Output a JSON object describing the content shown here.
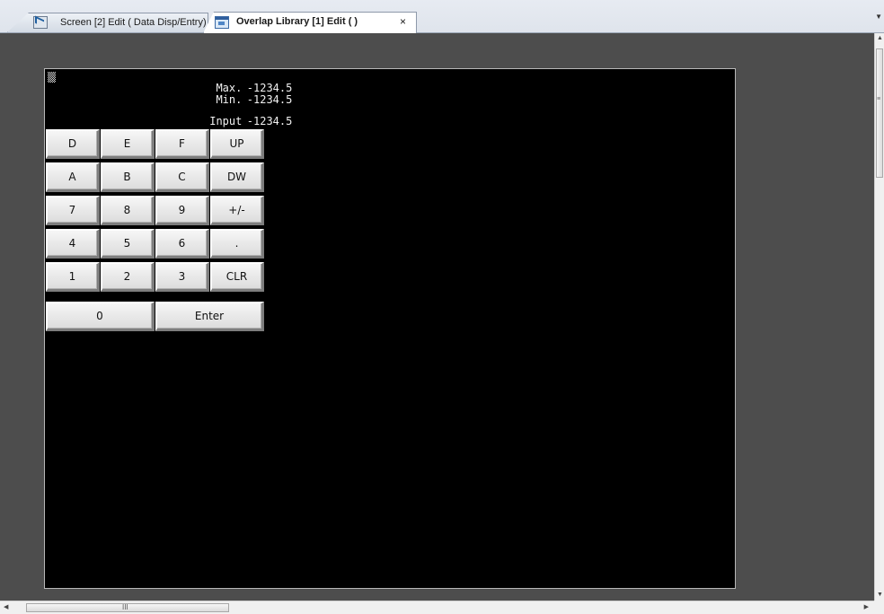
{
  "tabs": [
    {
      "label": "Screen [2] Edit ( Data Disp/Entry)",
      "icon": "screen-edit-icon",
      "active": false
    },
    {
      "label": "Overlap Library [1] Edit (          )",
      "icon": "overlap-library-icon",
      "active": true,
      "close": "×"
    }
  ],
  "hmi": {
    "background": "#000000",
    "max_label": "Max.",
    "max_value": "-1234.5",
    "min_label": "Min.",
    "min_value": "-1234.5",
    "input_label": "Input",
    "input_value": "-1234.5",
    "keys": [
      "D",
      "E",
      "F",
      "UP",
      "A",
      "B",
      "C",
      "DW",
      "7",
      "8",
      "9",
      "+/-",
      "4",
      "5",
      "6",
      ".",
      "1",
      "2",
      "3",
      "CLR"
    ],
    "zero_key": "0",
    "enter_key": "Enter"
  },
  "scrollbar": {
    "h_grip": "III",
    "v_grip": "≡"
  }
}
